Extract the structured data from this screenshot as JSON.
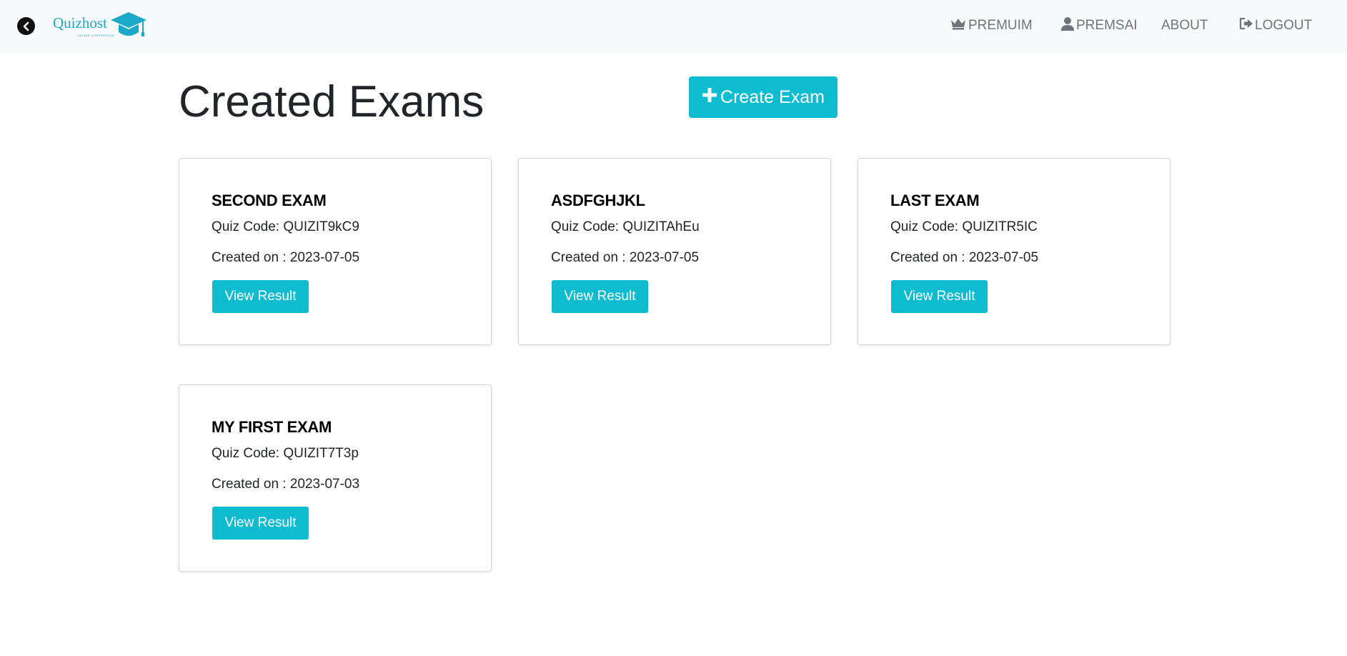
{
  "app": {
    "logo_text": "Quizhost",
    "logo_subtext": "ONLINE CONFERENCE"
  },
  "nav": {
    "premium": "PREMUIM",
    "user": "PREMSAI",
    "about": "ABOUT",
    "logout": "LOGOUT"
  },
  "icons": {
    "back": "chevron-left-circle",
    "logo": "graduation-cap",
    "premium": "crown",
    "user": "user",
    "logout": "sign-out",
    "create": "plus"
  },
  "colors": {
    "accent": "#0ebccf",
    "logo": "#1ca9c9",
    "nav_text": "#6c757d",
    "navbar_bg": "#f8f9fa"
  },
  "main": {
    "title": "Created Exams",
    "create_button": "Create Exam"
  },
  "exams": [
    {
      "title": "SECOND EXAM",
      "code": "Quiz Code: QUIZIT9kC9",
      "created": "Created on : 2023-07-05",
      "button": "View Result"
    },
    {
      "title": "ASDFGHJKL",
      "code": "Quiz Code: QUIZITAhEu",
      "created": "Created on : 2023-07-05",
      "button": "View Result"
    },
    {
      "title": "LAST EXAM",
      "code": "Quiz Code: QUIZITR5IC",
      "created": "Created on : 2023-07-05",
      "button": "View Result"
    },
    {
      "title": "MY FIRST EXAM",
      "code": "Quiz Code: QUIZIT7T3p",
      "created": "Created on : 2023-07-03",
      "button": "View Result"
    }
  ]
}
